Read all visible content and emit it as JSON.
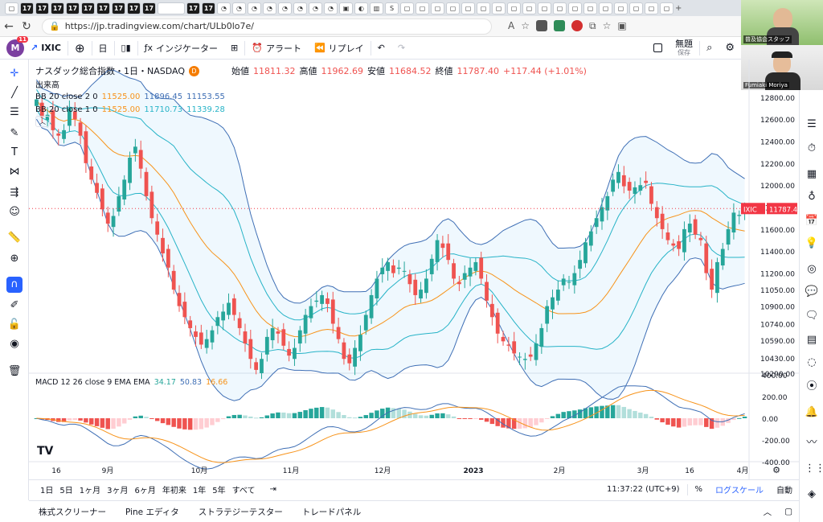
{
  "browser": {
    "url": "https://jp.tradingview.com/chart/ULb0lo7e/",
    "active_tab_close": "×",
    "new_tab": "+"
  },
  "video": {
    "tile1_label": "普及協会スタッフ",
    "tile2_label": "Fumiaki Moriya"
  },
  "toolbar": {
    "avatar_initial": "M",
    "notif_count": "11",
    "symbol": "IXIC",
    "interval": "日",
    "indicators": "インジケーター",
    "alert": "アラート",
    "replay": "リプレイ",
    "layout_name": "無題",
    "save": "保存"
  },
  "legend": {
    "title": "ナスダック総合指数・1日・NASDAQ",
    "d_badge": "D",
    "open_label": "始値",
    "open": "11811.32",
    "high_label": "高値",
    "high": "11962.69",
    "low_label": "安値",
    "low": "11684.52",
    "close_label": "終値",
    "close": "11787.40",
    "change": "+117.44 (+1.01%)",
    "volume": "出来高",
    "bb1_name": "BB 20 close 2 0",
    "bb1_v1": "11525.00",
    "bb1_v2": "11896.45",
    "bb1_v3": "11153.55",
    "bb2_name": "BB 20 close 1 0",
    "bb2_v1": "11525.00",
    "bb2_v2": "11710.73",
    "bb2_v3": "11339.28",
    "macd_name": "MACD 12 26 close 9 EMA EMA",
    "macd_v1": "34.17",
    "macd_v2": "50.83",
    "macd_v3": "16.66"
  },
  "price_axis": {
    "ticks": [
      "12800.00",
      "12600.00",
      "12400.00",
      "12200.00",
      "12000.00",
      "11800.00",
      "11600.00",
      "11400.00",
      "11200.00",
      "11050.00",
      "10900.00",
      "10740.00",
      "10590.00",
      "10430.00",
      "10290.00"
    ],
    "last_symbol": "IXIC",
    "last_price": "11787.40"
  },
  "macd_axis": {
    "ticks": [
      "400.00",
      "200.00",
      "0.00",
      "-200.00",
      "-400.00"
    ]
  },
  "time_axis": {
    "labels": [
      "16",
      "9月",
      "10月",
      "11月",
      "12月",
      "2023",
      "2月",
      "3月",
      "16",
      "4月"
    ]
  },
  "bottom": {
    "ranges": [
      "1日",
      "5日",
      "1ヶ月",
      "3ヶ月",
      "6ヶ月",
      "年初来",
      "1年",
      "5年",
      "すべて"
    ],
    "clock": "11:37:22 (UTC+9)",
    "percent": "%",
    "log": "ログスケール",
    "auto": "自動"
  },
  "panel": {
    "tabs": [
      "株式スクリーナー",
      "Pine エディタ",
      "ストラテジーテスター",
      "トレードパネル"
    ]
  },
  "colors": {
    "up": "#26a69a",
    "down": "#ef5350",
    "bb_outer": "#3f6fb5",
    "bb_inner": "#26b3c7",
    "basis": "#f7931a",
    "macd_line": "#3f6fb5",
    "signal_line": "#f7931a",
    "accent": "#2962ff",
    "last_tag": "#f23645"
  },
  "chart_data": {
    "type": "candlestick",
    "symbol": "IXIC",
    "ylim": [
      10290,
      12850
    ],
    "closes": [
      12780,
      12620,
      12640,
      12500,
      12450,
      12500,
      12700,
      12600,
      12450,
      12200,
      12050,
      11930,
      11780,
      11650,
      11720,
      11900,
      12050,
      12250,
      12350,
      12150,
      11900,
      11700,
      11550,
      11380,
      11250,
      11050,
      10900,
      10800,
      10700,
      10620,
      10550,
      10600,
      10680,
      10800,
      10850,
      10930,
      10820,
      10700,
      10560,
      10420,
      10320,
      10420,
      10620,
      10700,
      10650,
      10540,
      10450,
      10520,
      10680,
      10820,
      10900,
      10950,
      11000,
      10920,
      10740,
      10600,
      10420,
      10380,
      10520,
      10640,
      10820,
      11000,
      11150,
      11250,
      11300,
      11200,
      11250,
      11220,
      11100,
      11000,
      11050,
      11150,
      11330,
      11500,
      11430,
      11320,
      11150,
      11100,
      11200,
      11250,
      11300,
      11150,
      10950,
      10800,
      10650,
      10580,
      10540,
      10470,
      10440,
      10420,
      10440,
      10560,
      10700,
      10900,
      10980,
      11050,
      11150,
      11120,
      11200,
      11320,
      11480,
      11580,
      11700,
      11800,
      11900,
      12050,
      12120,
      11990,
      11950,
      11980,
      12000,
      12020,
      11830,
      11700,
      11600,
      11500,
      11450,
      11420,
      11600,
      11650,
      11550,
      11500,
      11200,
      11050,
      11300,
      11420,
      11600,
      11750,
      11730,
      11787
    ]
  }
}
